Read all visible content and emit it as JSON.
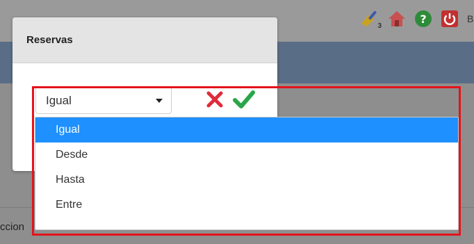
{
  "modal": {
    "title": "Reservas"
  },
  "select": {
    "value": "Igual",
    "options": [
      {
        "label": "Igual",
        "selected": true
      },
      {
        "label": "Desde",
        "selected": false
      },
      {
        "label": "Hasta",
        "selected": false
      },
      {
        "label": "Entre",
        "selected": false
      }
    ]
  },
  "actions": {
    "cancel_icon": "close-icon",
    "accept_icon": "check-icon"
  },
  "toolbar": {
    "broom_badge": "3",
    "user_initial": "B"
  },
  "background": {
    "bottom_text": "ccion"
  },
  "colors": {
    "selected_option": "#1e90ff",
    "highlight_border": "#e3141c",
    "cancel": "#e02b3a",
    "accept": "#2aa64a"
  }
}
